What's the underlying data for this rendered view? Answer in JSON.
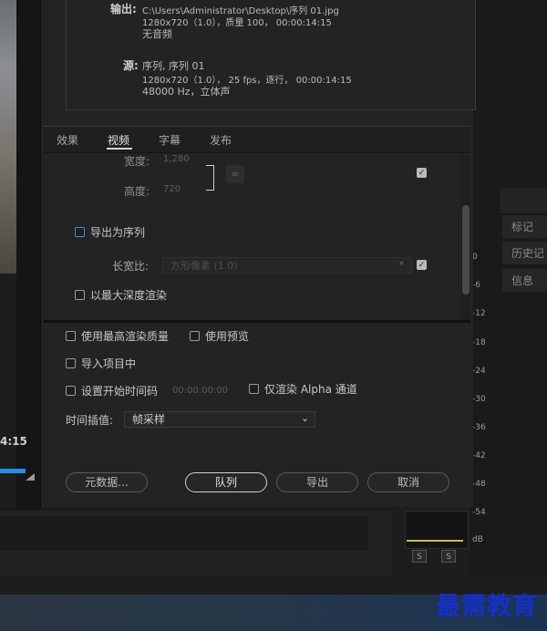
{
  "summary": {
    "output_label": "输出:",
    "output_path": "C:\\Users\\Administrator\\Desktop\\序列 01.jpg",
    "output_spec": "1280x720（1.0），质量 100， 00:00:14:15",
    "output_audio": "无音频",
    "source_label": "源:",
    "source_name": "序列, 序列 01",
    "source_spec": "1280x720（1.0）， 25 fps，逐行， 00:00:14:15",
    "source_audio": "48000 Hz，立体声"
  },
  "tabs": [
    {
      "label": "效果",
      "active": false
    },
    {
      "label": "视频",
      "active": true
    },
    {
      "label": "字幕",
      "active": false
    },
    {
      "label": "发布",
      "active": false
    }
  ],
  "video": {
    "width_label": "宽度:",
    "width_value": "1,280",
    "height_label": "高度:",
    "height_value": "720",
    "export_sequence_label": "导出为序列",
    "aspect_label": "长宽比:",
    "aspect_value": "方形像素 (1.0)",
    "max_depth_label": "以最大深度渲染"
  },
  "options": {
    "max_quality": "使用最高渲染质量",
    "use_preview": "使用预览",
    "import_project": "导入项目中",
    "set_start_tc": "设置开始时间码",
    "start_tc_value": "00:00:00:00",
    "alpha_only": "仅渲染 Alpha 通道",
    "interp_label": "时间插值:",
    "interp_value": "帧采样"
  },
  "buttons": {
    "metadata": "元数据...",
    "queue": "队列",
    "export": "导出",
    "cancel": "取消"
  },
  "background": {
    "timecode": "4:15",
    "side_tabs": [
      "标记",
      "历史记",
      "信息"
    ],
    "meter_labels": [
      "0",
      "-6",
      "-12",
      "-18",
      "-24",
      "-30",
      "-36",
      "-42",
      "-48",
      "-54",
      "dB"
    ],
    "solo_label": "S",
    "watermark": "最需教育"
  }
}
